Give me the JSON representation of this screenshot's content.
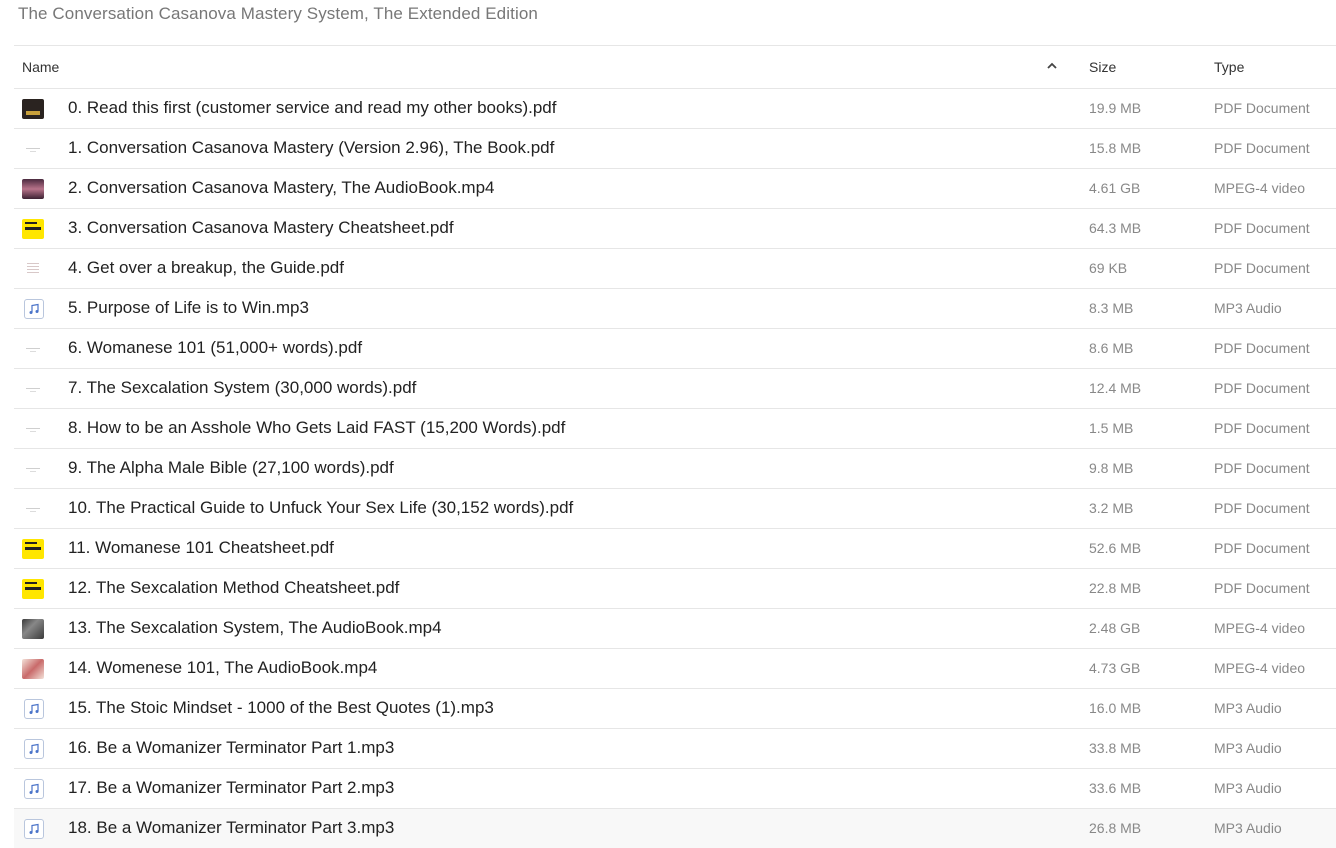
{
  "folder_title": "The Conversation Casanova Mastery System, The Extended Edition",
  "columns": {
    "name": "Name",
    "size": "Size",
    "type": "Type"
  },
  "files": [
    {
      "name": "0. Read this first (customer service and read my other books).pdf",
      "size": "19.9 MB",
      "type": "PDF Document",
      "thumb": "dark-cover"
    },
    {
      "name": "1. Conversation Casanova Mastery (Version 2.96), The Book.pdf",
      "size": "15.8 MB",
      "type": "PDF Document",
      "thumb": "blank-page"
    },
    {
      "name": "2. Conversation Casanova Mastery, The AudioBook.mp4",
      "size": "4.61 GB",
      "type": "MPEG-4 video",
      "thumb": "pink-cover"
    },
    {
      "name": "3. Conversation Casanova Mastery Cheatsheet.pdf",
      "size": "64.3 MB",
      "type": "PDF Document",
      "thumb": "yellow-cover"
    },
    {
      "name": "4. Get over a breakup, the Guide.pdf",
      "size": "69 KB",
      "type": "PDF Document",
      "thumb": "text-page"
    },
    {
      "name": "5. Purpose of Life is to Win.mp3",
      "size": "8.3 MB",
      "type": "MP3 Audio",
      "thumb": "music-note"
    },
    {
      "name": "6. Womanese 101 (51,000+ words).pdf",
      "size": "8.6 MB",
      "type": "PDF Document",
      "thumb": "blank-page"
    },
    {
      "name": "7. The Sexcalation System (30,000 words).pdf",
      "size": "12.4 MB",
      "type": "PDF Document",
      "thumb": "blank-page"
    },
    {
      "name": "8. How to be an Asshole Who Gets Laid FAST (15,200 Words).pdf",
      "size": "1.5 MB",
      "type": "PDF Document",
      "thumb": "blank-page"
    },
    {
      "name": "9. The Alpha Male Bible (27,100 words).pdf",
      "size": "9.8 MB",
      "type": "PDF Document",
      "thumb": "blank-page"
    },
    {
      "name": "10. The Practical Guide to Unfuck Your Sex Life (30,152 words).pdf",
      "size": "3.2 MB",
      "type": "PDF Document",
      "thumb": "blank-page"
    },
    {
      "name": "11. Womanese 101 Cheatsheet.pdf",
      "size": "52.6 MB",
      "type": "PDF Document",
      "thumb": "yellow-cover"
    },
    {
      "name": "12. The Sexcalation Method Cheatsheet.pdf",
      "size": "22.8 MB",
      "type": "PDF Document",
      "thumb": "yellow-cover"
    },
    {
      "name": "13. The Sexcalation System, The AudioBook.mp4",
      "size": "2.48 GB",
      "type": "MPEG-4 video",
      "thumb": "video-dark"
    },
    {
      "name": "14. Womenese 101, The AudioBook.mp4",
      "size": "4.73 GB",
      "type": "MPEG-4 video",
      "thumb": "video-light"
    },
    {
      "name": "15. The Stoic Mindset - 1000 of the Best Quotes (1).mp3",
      "size": "16.0 MB",
      "type": "MP3 Audio",
      "thumb": "music-note"
    },
    {
      "name": "16. Be a Womanizer Terminator Part 1.mp3",
      "size": "33.8 MB",
      "type": "MP3 Audio",
      "thumb": "music-note"
    },
    {
      "name": "17. Be a Womanizer Terminator Part 2.mp3",
      "size": "33.6 MB",
      "type": "MP3 Audio",
      "thumb": "music-note"
    },
    {
      "name": "18. Be a Womanizer Terminator Part 3.mp3",
      "size": "26.8 MB",
      "type": "MP3 Audio",
      "thumb": "music-note"
    }
  ],
  "sort": {
    "column": "name",
    "direction": "ascending",
    "icon": "chevron-up-icon"
  },
  "colors": {
    "text": "#222222",
    "muted": "#888888",
    "divider": "#e6e6e6",
    "music_icon": "#4a73c9"
  }
}
